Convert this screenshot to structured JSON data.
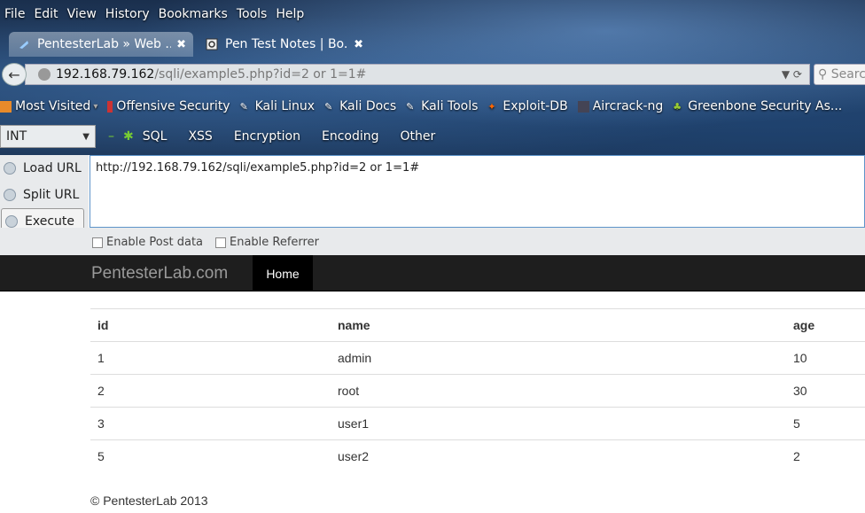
{
  "menu": [
    "File",
    "Edit",
    "View",
    "History",
    "Bookmarks",
    "Tools",
    "Help"
  ],
  "tabs": [
    {
      "title": "PentesterLab » Web ...",
      "close": "✖"
    },
    {
      "title": "Pen Test Notes | Bo...",
      "close": "✖"
    }
  ],
  "urlbar": {
    "host": "192.168.79.162",
    "path": "/sqli/example5.php?id=2 or 1=1#",
    "search_placeholder": "Searc"
  },
  "bookmarks": [
    "Most Visited",
    "Offensive Security",
    "Kali Linux",
    "Kali Docs",
    "Kali Tools",
    "Exploit-DB",
    "Aircrack-ng",
    "Greenbone Security As..."
  ],
  "hackbar": {
    "select_value": "INT",
    "menus": [
      "SQL",
      "XSS",
      "Encryption",
      "Encoding",
      "Other"
    ],
    "load_url": "Load URL",
    "split_url": "Split URL",
    "execute": "Execute",
    "url_text": "http://192.168.79.162/sqli/example5.php?id=2 or 1=1#",
    "enable_post": "Enable Post data",
    "enable_referrer": "Enable Referrer"
  },
  "site": {
    "brand": "PentesterLab.com",
    "nav_home": "Home",
    "table": {
      "headers": [
        "id",
        "name",
        "age"
      ],
      "rows": [
        [
          "1",
          "admin",
          "10"
        ],
        [
          "2",
          "root",
          "30"
        ],
        [
          "3",
          "user1",
          "5"
        ],
        [
          "5",
          "user2",
          "2"
        ]
      ]
    },
    "footer": "© PentesterLab 2013"
  }
}
